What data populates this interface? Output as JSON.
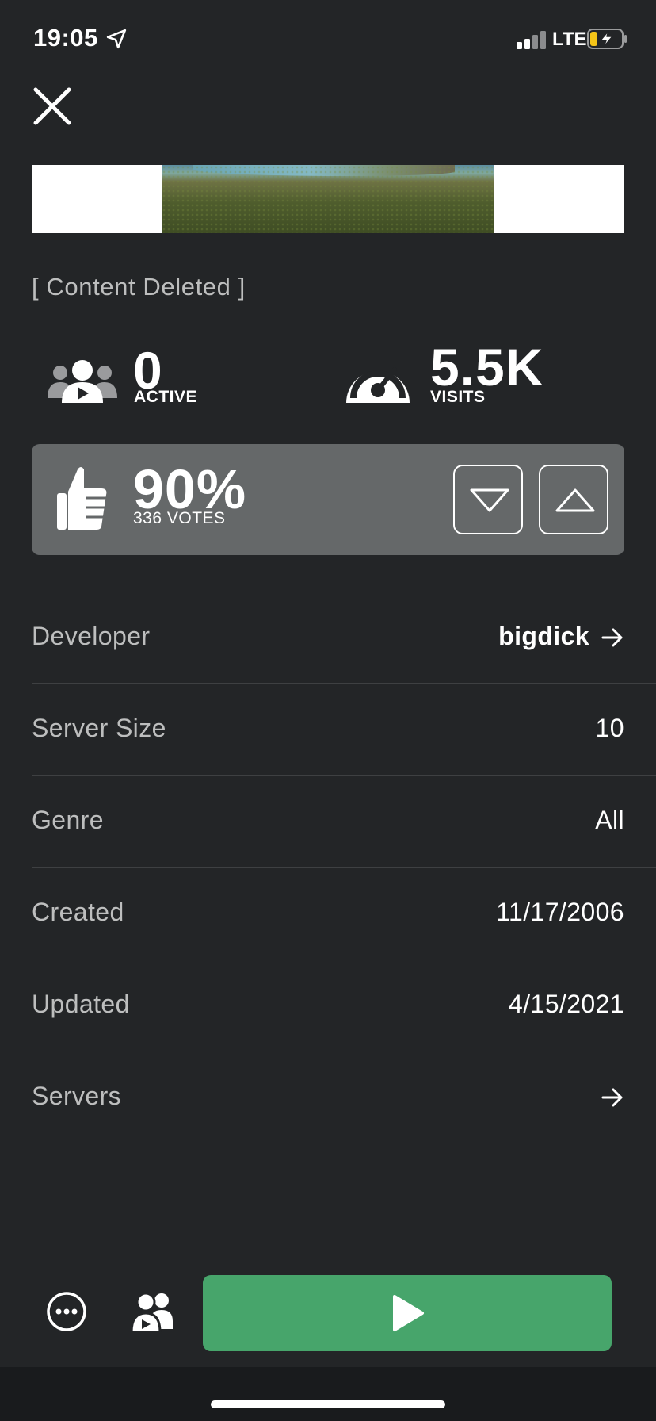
{
  "status_bar": {
    "time": "19:05",
    "network": "LTE",
    "icons": [
      "location-arrow-icon",
      "signal-icon",
      "battery-charging-icon"
    ]
  },
  "header": {
    "close_icon": "close-icon"
  },
  "game": {
    "title": "[ Content Deleted ]"
  },
  "stats": {
    "active_value": "0",
    "active_label": "ACTIVE",
    "visits_value": "5.5K",
    "visits_label": "VISITS"
  },
  "votes": {
    "percent": "90%",
    "count_label": "336 VOTES"
  },
  "details": [
    {
      "label": "Developer",
      "value": "bigdick"
    },
    {
      "label": "Server Size",
      "value": "10"
    },
    {
      "label": "Genre",
      "value": "All"
    },
    {
      "label": "Created",
      "value": "11/17/2006"
    },
    {
      "label": "Updated",
      "value": "4/15/2021"
    },
    {
      "label": "Servers",
      "value": ""
    }
  ],
  "colors": {
    "background": "#232527",
    "panel": "#656869",
    "play": "#47a56b",
    "label": "#bdbebe",
    "battery_fill": "#f5c518"
  }
}
